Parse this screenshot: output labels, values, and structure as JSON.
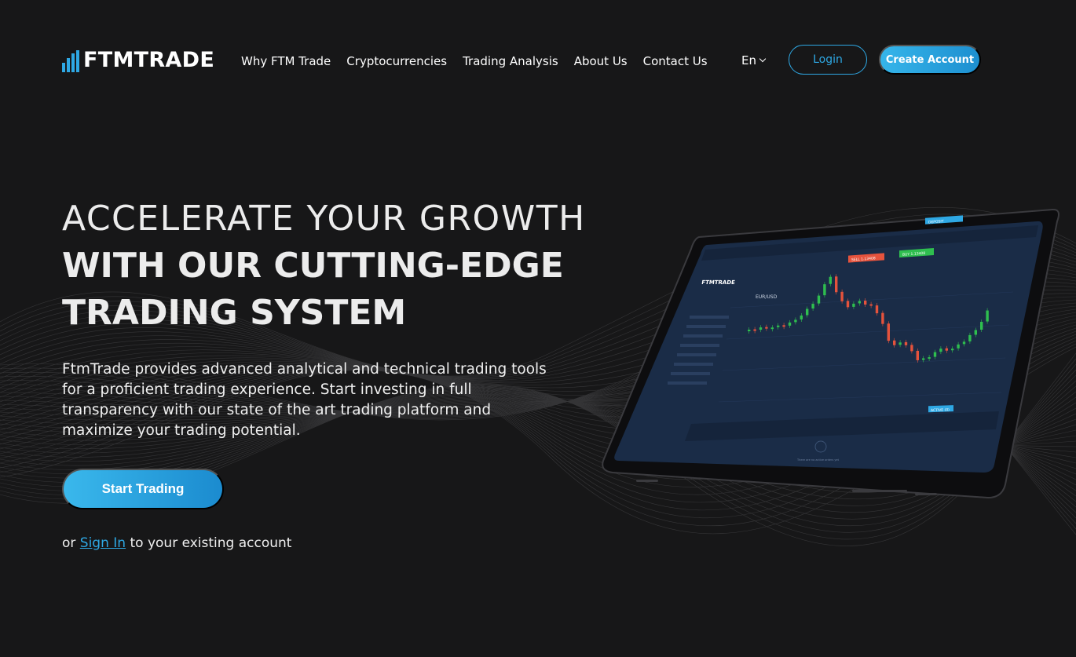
{
  "brand": {
    "name": "FTMTRADE",
    "accent": "#2ea8e4"
  },
  "nav": {
    "items": [
      "Why FTM Trade",
      "Cryptocurrencies",
      "Trading Analysis",
      "About Us",
      "Contact Us"
    ],
    "language": "En",
    "login_label": "Login",
    "create_account_label": "Create Account"
  },
  "hero": {
    "title_line1": "ACCELERATE YOUR GROWTH",
    "title_line2": "WITH OUR CUTTING-EDGE",
    "title_line3": "TRADING SYSTEM",
    "description": "FtmTrade provides advanced analytical and technical trading tools for a proficient trading experience. Start investing in full transparency with our state of the art trading platform and maximize your trading potential.",
    "cta_label": "Start Trading",
    "signin_prefix": "or",
    "signin_link": "Sign In",
    "signin_suffix": "to your existing account"
  },
  "tablet_screen": {
    "app_logo": "FTMTRADE",
    "pair": "EUR/USD",
    "sell_label": "SELL 1.13408",
    "buy_label": "BUY 1.13408",
    "deposit_label": "DEPOSIT",
    "active_label": "ACTIVE (0)",
    "empty_note": "There are no active orders yet"
  },
  "colors": {
    "background": "#171718",
    "candle_up": "#2fbf4f",
    "candle_down": "#e5533d",
    "screen_bg": "#1a2c47"
  }
}
